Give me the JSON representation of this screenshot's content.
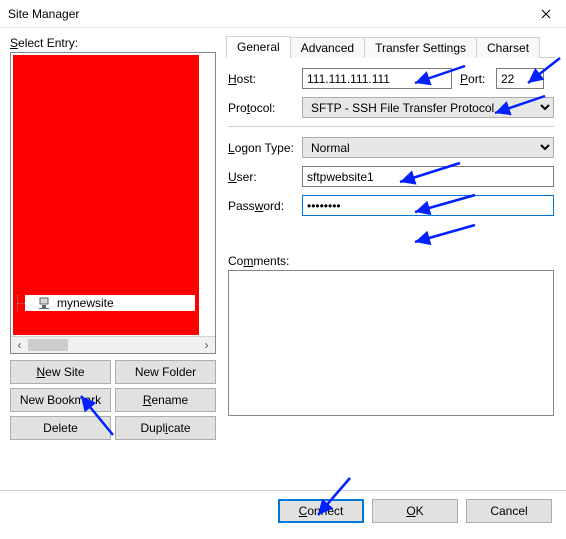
{
  "window": {
    "title": "Site Manager"
  },
  "left": {
    "label": "Select Entry:",
    "site_name": "mynewsite",
    "buttons": {
      "new_site": "New Site",
      "new_folder": "New Folder",
      "new_bookmark": "New Bookmark",
      "rename": "Rename",
      "delete": "Delete",
      "duplicate": "Duplicate"
    }
  },
  "tabs": {
    "general": "General",
    "advanced": "Advanced",
    "transfer": "Transfer Settings",
    "charset": "Charset"
  },
  "form": {
    "host_label": "Host:",
    "host_value": "111.111.111.111",
    "port_label": "Port:",
    "port_value": "22",
    "protocol_label": "Protocol:",
    "protocol_value": "SFTP - SSH File Transfer Protocol",
    "logon_label": "Logon Type:",
    "logon_value": "Normal",
    "user_label": "User:",
    "user_value": "sftpwebsite1",
    "password_label": "Password:",
    "password_value": "••••••••",
    "comments_label": "Comments:",
    "comments_value": ""
  },
  "footer": {
    "connect": "Connect",
    "ok": "OK",
    "cancel": "Cancel"
  }
}
